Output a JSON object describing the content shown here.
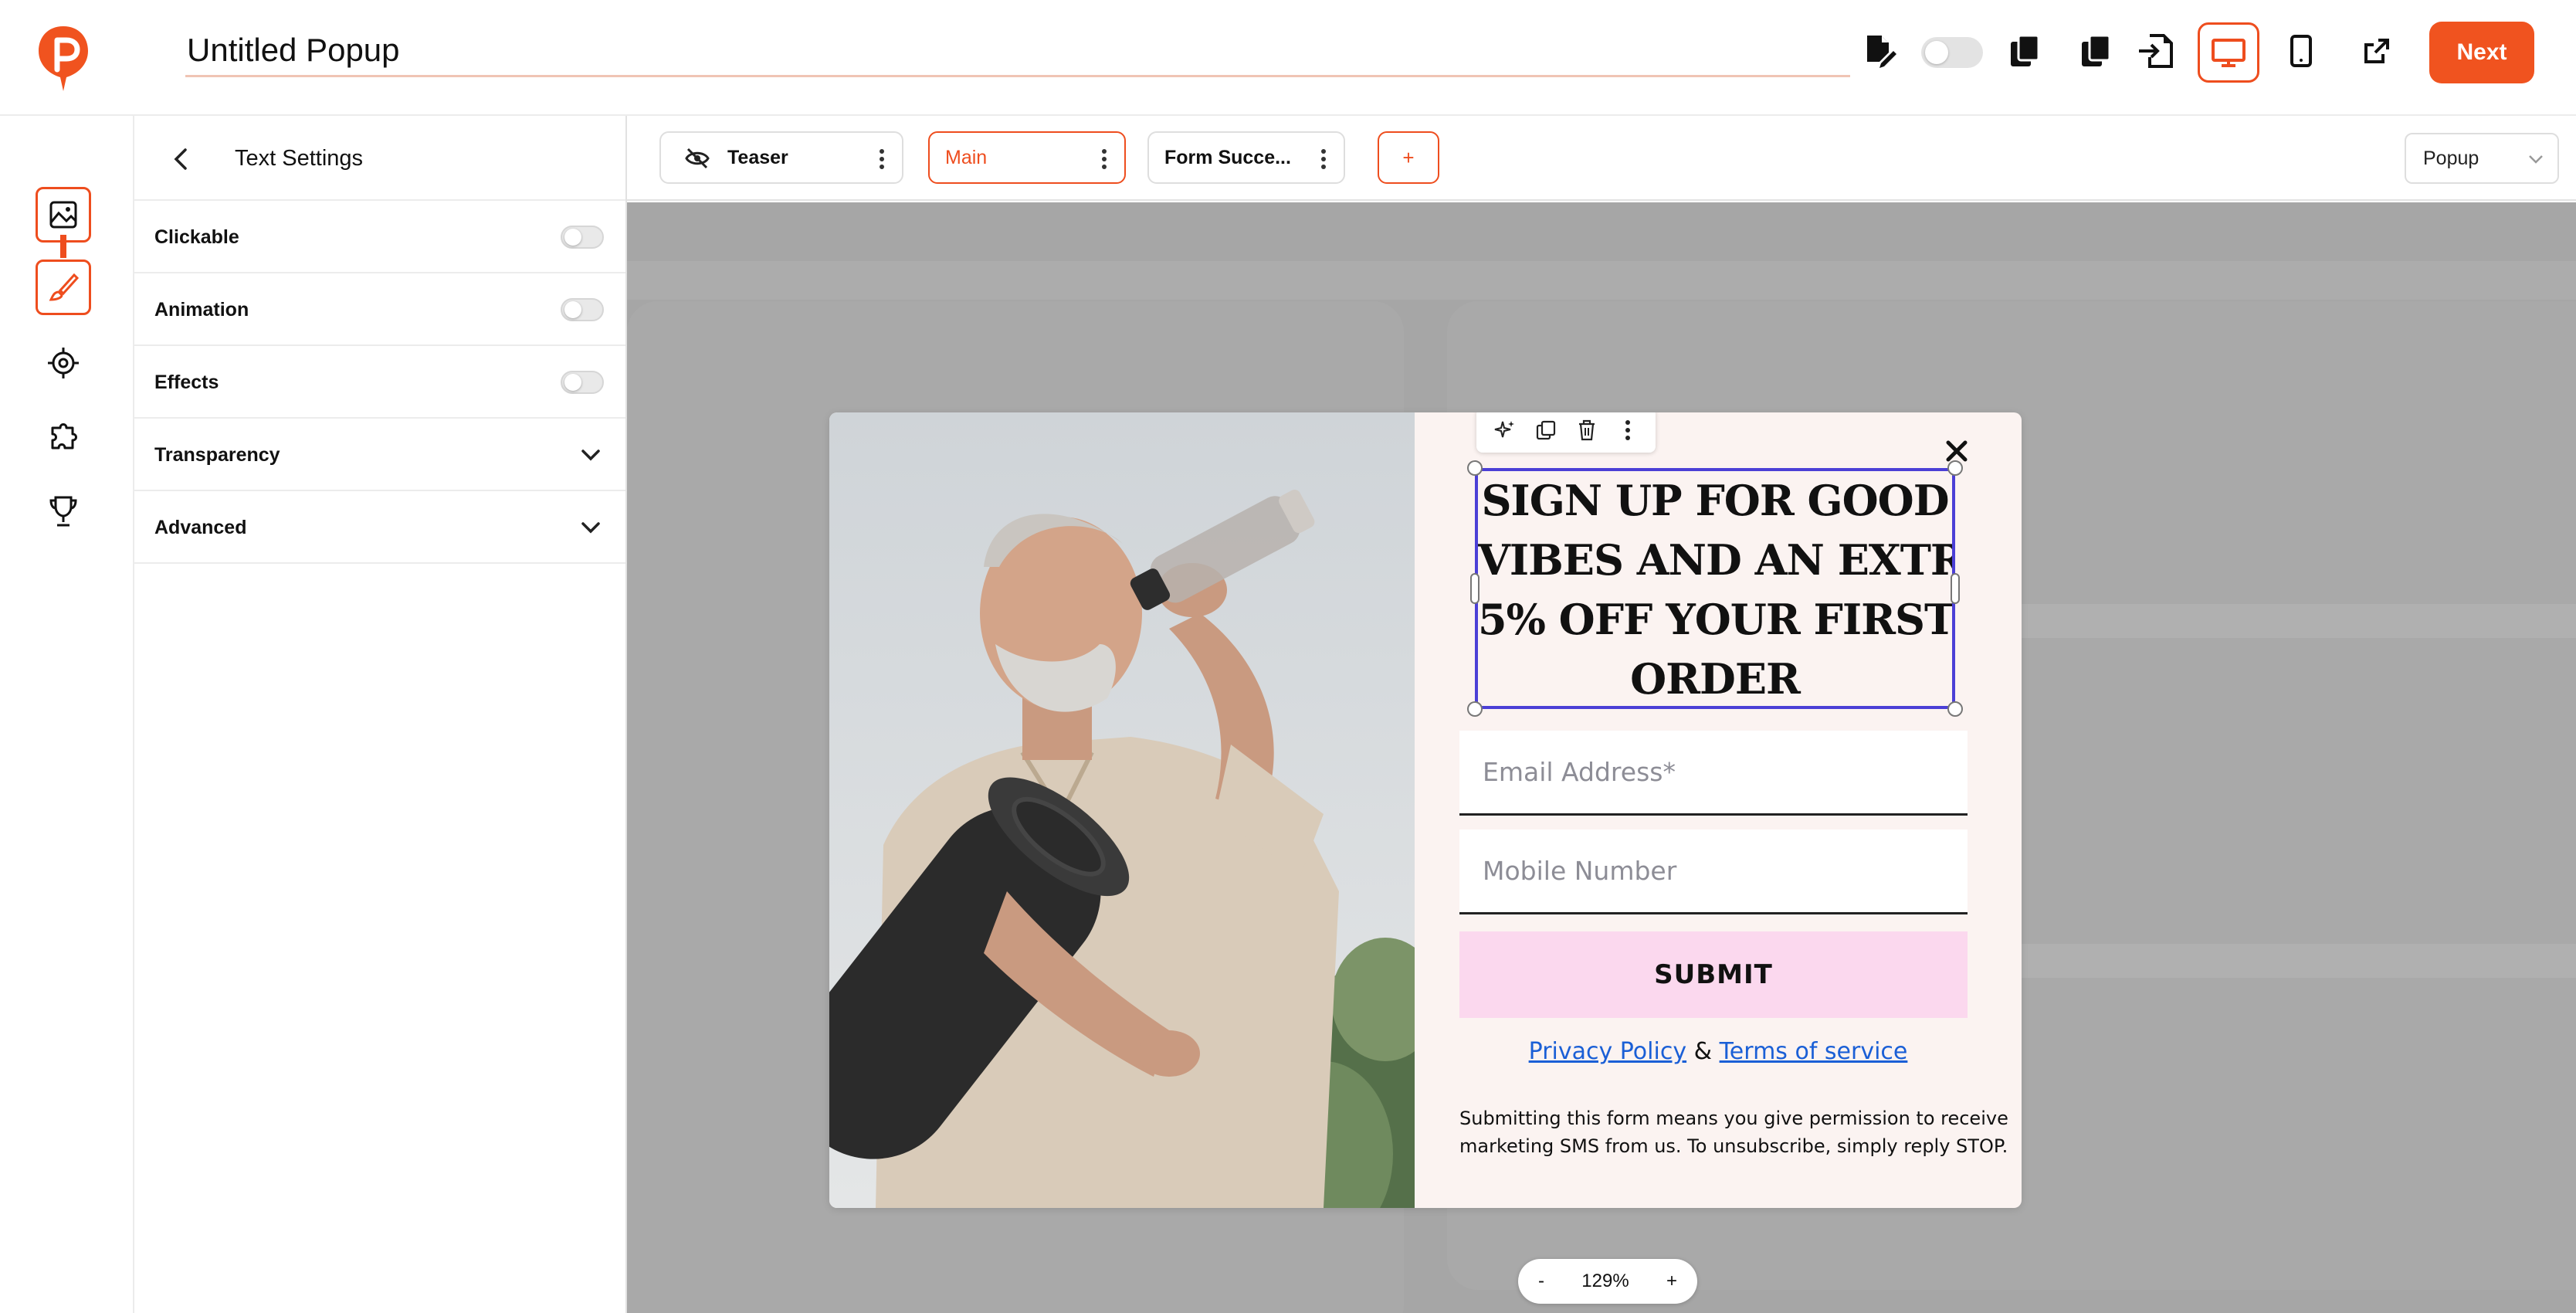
{
  "app": {
    "popup_title": "Untitled Popup",
    "next_label": "Next"
  },
  "toolbar_icons": [
    "edit-document-icon",
    "preview-toggle",
    "copy-icon",
    "duplicate-icon",
    "import-icon",
    "desktop-icon",
    "mobile-icon",
    "external-link-icon"
  ],
  "sidebar": {
    "items": [
      "image-icon",
      "brush-icon",
      "target-icon",
      "puzzle-icon",
      "trophy-icon"
    ]
  },
  "panel": {
    "title": "Text Settings",
    "rows": [
      {
        "label": "Clickable",
        "control": "switch",
        "on": false
      },
      {
        "label": "Animation",
        "control": "switch",
        "on": false
      },
      {
        "label": "Effects",
        "control": "switch",
        "on": false
      },
      {
        "label": "Transparency",
        "control": "expand"
      },
      {
        "label": "Advanced",
        "control": "expand"
      }
    ]
  },
  "steps": {
    "tabs": [
      {
        "label": "Teaser",
        "hidden_icon": true,
        "active": false
      },
      {
        "label": "Main",
        "active": true
      },
      {
        "label": "Form Succe...",
        "active": false
      }
    ],
    "add_label": "+",
    "type_select": "Popup"
  },
  "popup": {
    "headline_lines": [
      "SIGN UP FOR GOOD",
      "VIBES AND AN EXTRA",
      "5% OFF YOUR FIRST",
      "ORDER"
    ],
    "email_placeholder": "Email Address*",
    "mobile_placeholder": "Mobile Number",
    "submit_label": "SUBMIT",
    "privacy_label": "Privacy Policy",
    "amp": "&",
    "terms_label": "Terms of service",
    "note_lines": [
      "Submitting this form means you give permission to receive",
      "marketing SMS from us.  To unsubscribe, simply reply STOP."
    ]
  },
  "zoom": {
    "minus": "-",
    "value": "129%",
    "plus": "+"
  },
  "colors": {
    "accent": "#f0531f",
    "selection": "#4b3fd6",
    "submit_bg": "#fbd8ee",
    "popup_bg": "#fbf3f1",
    "canvas_bg": "#a6a6a6"
  }
}
